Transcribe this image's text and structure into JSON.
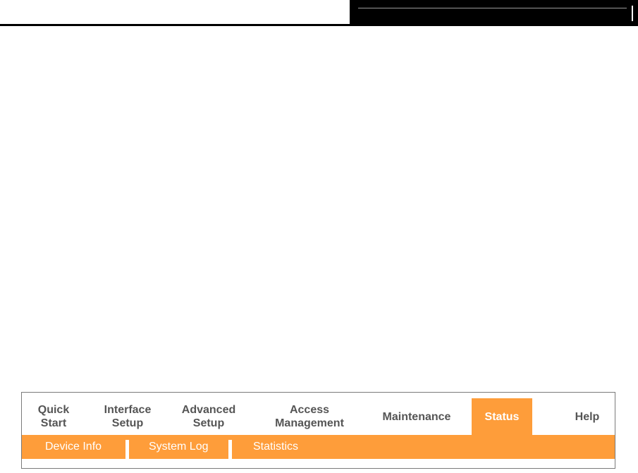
{
  "nav": {
    "main_items": [
      {
        "label": "Quick\nStart"
      },
      {
        "label": "Interface\nSetup"
      },
      {
        "label": "Advanced\nSetup"
      },
      {
        "label": "Access\nManagement"
      },
      {
        "label": "Maintenance"
      },
      {
        "label": "Status",
        "active": true
      },
      {
        "label": "Help"
      }
    ],
    "sub_items": [
      {
        "label": "Device Info"
      },
      {
        "label": "System Log"
      },
      {
        "label": "Statistics"
      }
    ]
  },
  "colors": {
    "accent_orange": "#fe9d3a",
    "menu_text": "#555555",
    "active_text": "#ffffff",
    "header_black": "#000000"
  }
}
